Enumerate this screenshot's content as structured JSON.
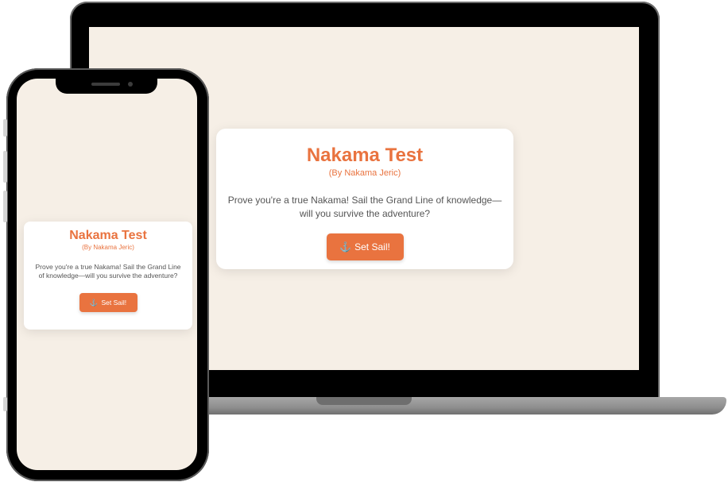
{
  "app": {
    "title": "Nakama Test",
    "subtitle": "(By Nakama Jeric)",
    "description": "Prove you're a true Nakama! Sail the Grand Line of knowledge—will you survive the adventure?",
    "cta_label": "Set Sail!",
    "cta_icon": "anchor-icon",
    "cta_icon_glyph": "⚓"
  },
  "colors": {
    "accent": "#e9733f",
    "screen_background": "#f6efe6",
    "card_background": "#ffffff",
    "body_text": "#555555"
  }
}
